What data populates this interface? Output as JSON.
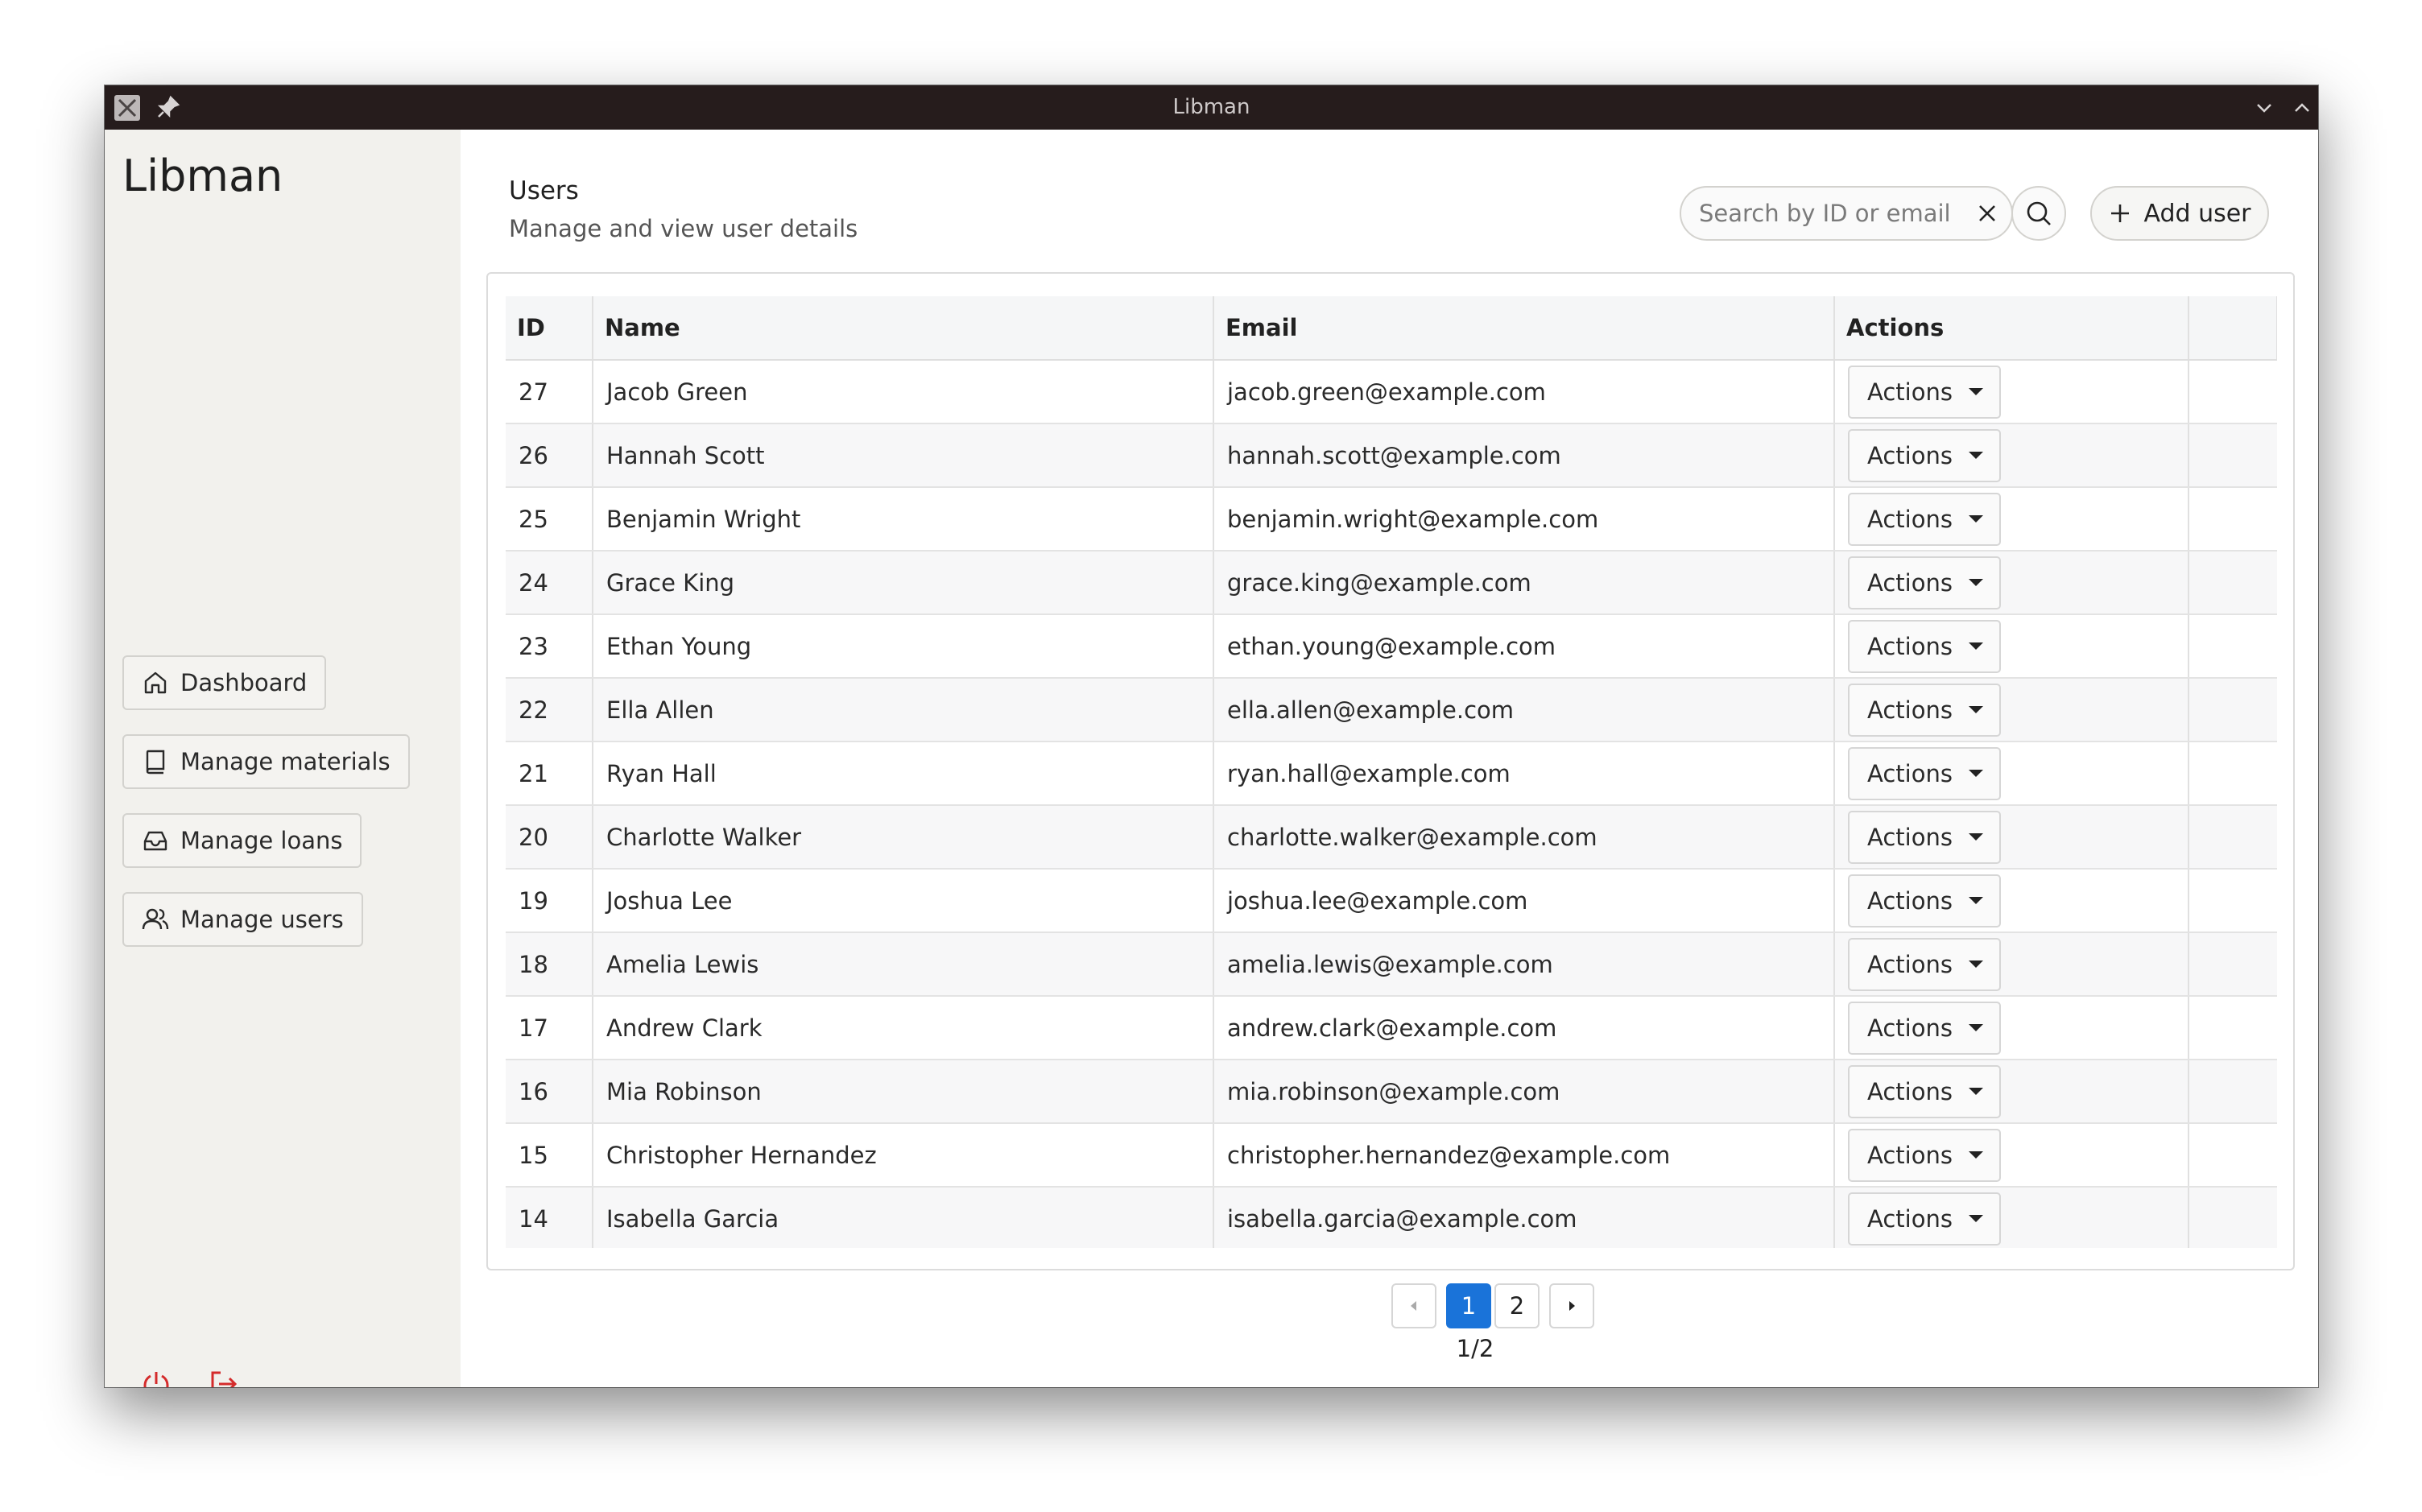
{
  "window": {
    "title": "Libman"
  },
  "sidebar": {
    "brand": "Libman",
    "items": [
      {
        "label": "Dashboard",
        "icon": "home-icon"
      },
      {
        "label": "Manage materials",
        "icon": "book-icon"
      },
      {
        "label": "Manage loans",
        "icon": "inbox-icon"
      },
      {
        "label": "Manage users",
        "icon": "users-icon"
      }
    ],
    "bottom_icons": [
      "power-icon",
      "logout-icon"
    ]
  },
  "header": {
    "title": "Users",
    "subtitle": "Manage and view user details",
    "search_placeholder": "Search by ID or email",
    "search_value": "",
    "add_label": "Add user"
  },
  "table": {
    "columns": [
      "ID",
      "Name",
      "Email",
      "Actions"
    ],
    "action_label": "Actions",
    "rows": [
      {
        "id": "27",
        "name": "Jacob Green",
        "email": "jacob.green@example.com"
      },
      {
        "id": "26",
        "name": "Hannah Scott",
        "email": "hannah.scott@example.com"
      },
      {
        "id": "25",
        "name": "Benjamin Wright",
        "email": "benjamin.wright@example.com"
      },
      {
        "id": "24",
        "name": "Grace King",
        "email": "grace.king@example.com"
      },
      {
        "id": "23",
        "name": "Ethan Young",
        "email": "ethan.young@example.com"
      },
      {
        "id": "22",
        "name": "Ella Allen",
        "email": "ella.allen@example.com"
      },
      {
        "id": "21",
        "name": "Ryan Hall",
        "email": "ryan.hall@example.com"
      },
      {
        "id": "20",
        "name": "Charlotte Walker",
        "email": "charlotte.walker@example.com"
      },
      {
        "id": "19",
        "name": "Joshua Lee",
        "email": "joshua.lee@example.com"
      },
      {
        "id": "18",
        "name": "Amelia Lewis",
        "email": "amelia.lewis@example.com"
      },
      {
        "id": "17",
        "name": "Andrew Clark",
        "email": "andrew.clark@example.com"
      },
      {
        "id": "16",
        "name": "Mia Robinson",
        "email": "mia.robinson@example.com"
      },
      {
        "id": "15",
        "name": "Christopher Hernandez",
        "email": "christopher.hernandez@example.com"
      },
      {
        "id": "14",
        "name": "Isabella Garcia",
        "email": "isabella.garcia@example.com"
      }
    ]
  },
  "pagination": {
    "pages": [
      "1",
      "2"
    ],
    "current": "1",
    "status": "1/2"
  },
  "colors": {
    "accent": "#1a73d9",
    "danger": "#d42b2b",
    "titlebar": "#261c1c",
    "sidebar_bg": "#f2f1ed"
  }
}
